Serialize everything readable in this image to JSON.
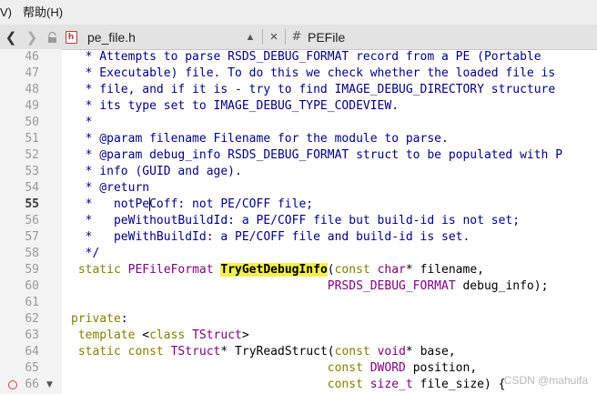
{
  "menubar": {
    "items": [
      {
        "label": "V)"
      },
      {
        "label": "帮助(H)"
      }
    ]
  },
  "toolbar": {
    "back_icon": "chevron-left",
    "forward_icon": "chevron-right",
    "file_icon_letter": "h",
    "file_name": "pe_file.h",
    "close_icon": "×",
    "symbol_icon": "#",
    "symbol_name": "PEFile"
  },
  "editor": {
    "current_line": 55,
    "breakpoint_line": 66,
    "lines": [
      {
        "n": "46",
        "t": "  * Attempts to parse RSDS_DEBUG_FORMAT record from a PE (Portable"
      },
      {
        "n": "47",
        "t": "  * Executable) file. To do this we check whether the loaded file is"
      },
      {
        "n": "48",
        "t": "  * file, and if it is - try to find IMAGE_DEBUG_DIRECTORY structure"
      },
      {
        "n": "49",
        "t": "  * its type set to IMAGE_DEBUG_TYPE_CODEVIEW."
      },
      {
        "n": "50",
        "t": "  *"
      },
      {
        "n": "51",
        "t": "  * @param filename Filename for the module to parse."
      },
      {
        "n": "52",
        "t": "  * @param debug_info RSDS_DEBUG_FORMAT struct to be populated with P"
      },
      {
        "n": "53",
        "t": "  * info (GUID and age)."
      },
      {
        "n": "54",
        "t": "  * @return"
      },
      {
        "n": "55",
        "t": "  *   notPeCoff: not PE/COFF file;"
      },
      {
        "n": "56",
        "t": "  *   peWithoutBuildId: a PE/COFF file but build-id is not set;"
      },
      {
        "n": "57",
        "t": "  *   peWithBuildId: a PE/COFF file and build-id is set."
      },
      {
        "n": "58",
        "t": "  */"
      },
      {
        "n": "59",
        "t": " static PEFileFormat TryGetDebugInfo(const char* filename,"
      },
      {
        "n": "60",
        "t": "                                    PRSDS_DEBUG_FORMAT debug_info);"
      },
      {
        "n": "61",
        "t": ""
      },
      {
        "n": "62",
        "t": "private:"
      },
      {
        "n": "63",
        "t": " template <class TStruct>"
      },
      {
        "n": "64",
        "t": " static const TStruct* TryReadStruct(const void* base,"
      },
      {
        "n": "65",
        "t": "                                    const DWORD position,"
      },
      {
        "n": "66",
        "t": "                                    const size_t file_size) {"
      }
    ]
  },
  "watermark": "CSDN @mahuifa",
  "colors": {
    "comment": "#000080",
    "keyword": "#808000",
    "type": "#800080",
    "highlight": "#f3ef4b",
    "gutter": "#f3f3f3",
    "line_number": "#9a9a9a"
  }
}
